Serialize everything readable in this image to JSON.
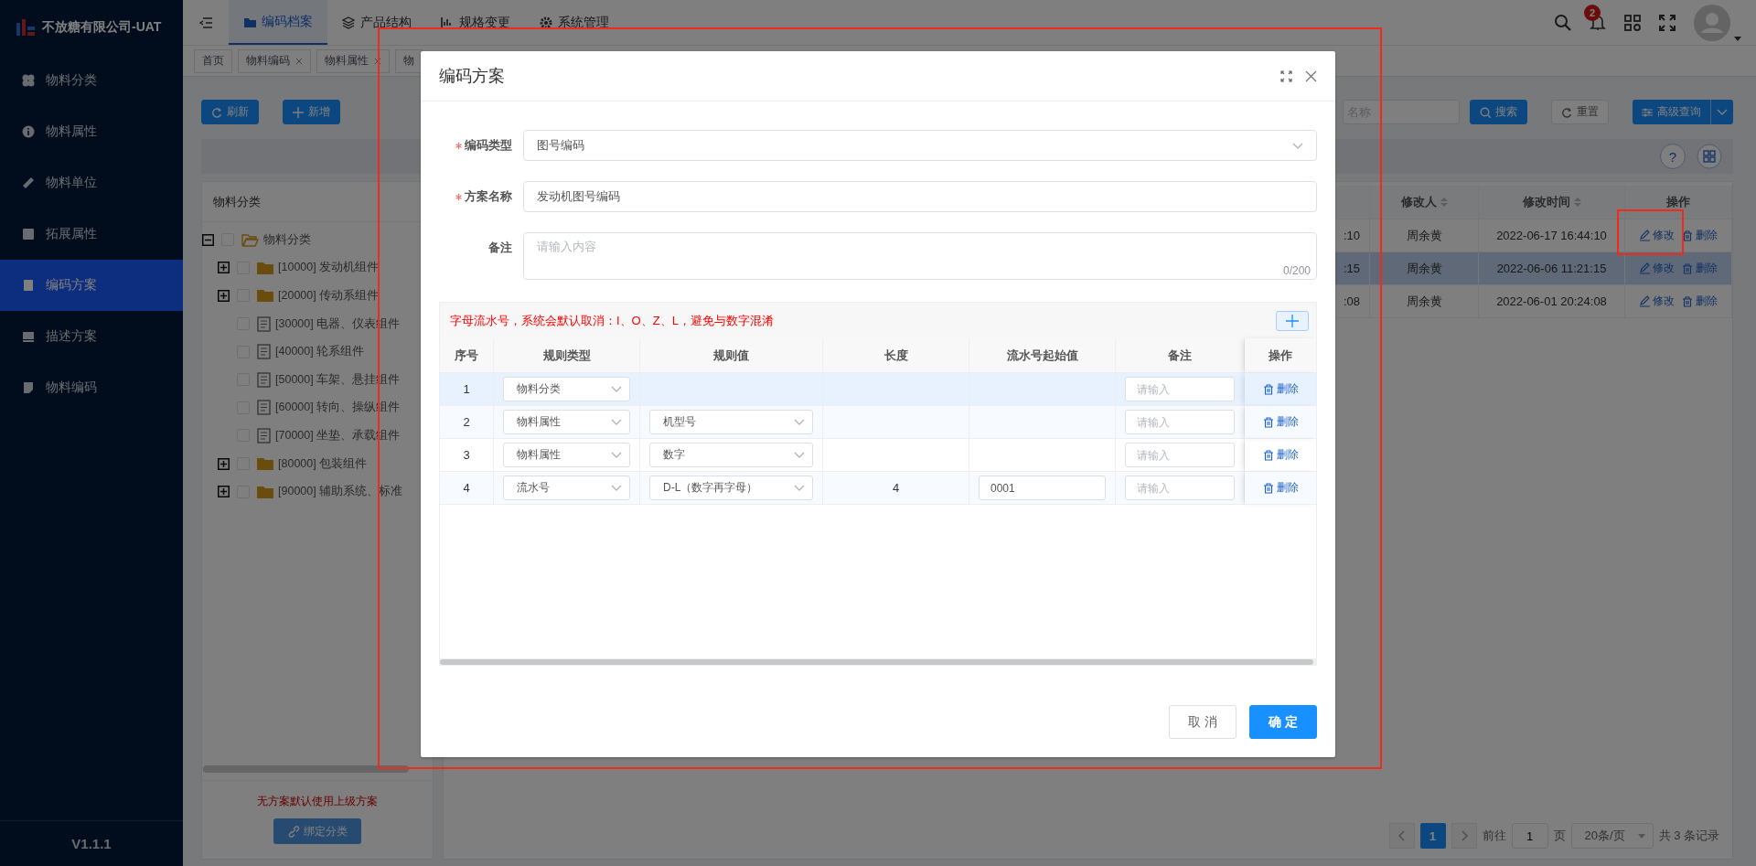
{
  "app": {
    "company": "不放糖有限公司-UAT",
    "version": "V1.1.1"
  },
  "sidebar": {
    "items": [
      {
        "label": "物料分类",
        "selected": false
      },
      {
        "label": "物料属性",
        "selected": false
      },
      {
        "label": "物料单位",
        "selected": false
      },
      {
        "label": "拓展属性",
        "selected": false
      },
      {
        "label": "编码方案",
        "selected": true
      },
      {
        "label": "描述方案",
        "selected": false
      },
      {
        "label": "物料编码",
        "selected": false
      }
    ]
  },
  "top_nav": {
    "tabs": [
      {
        "label": "编码档案",
        "selected": true
      },
      {
        "label": "产品结构",
        "selected": false
      },
      {
        "label": "规格变更",
        "selected": false
      },
      {
        "label": "系统管理",
        "selected": false
      }
    ],
    "notification_count": "2"
  },
  "tag_tabs": [
    {
      "label": "首页",
      "closable": false
    },
    {
      "label": "物料编码",
      "closable": true
    },
    {
      "label": "物料属性",
      "closable": true
    },
    {
      "label": "物",
      "closable": false
    }
  ],
  "toolbar": {
    "buttons": [
      {
        "label": "刷新",
        "kind": "refresh"
      },
      {
        "label": "新增",
        "kind": "add"
      }
    ],
    "search": {
      "placeholder": "名称"
    },
    "help_button": "?",
    "search_buttons": [
      {
        "label": "搜索",
        "kind": "search"
      },
      {
        "label": "重置",
        "kind": "reset"
      },
      {
        "label": "高级查询",
        "kind": "advanced"
      }
    ]
  },
  "category_panel": {
    "title": "物料分类",
    "tree": [
      {
        "label": "物料分类",
        "kind": "folder",
        "expanded": true,
        "checked": false,
        "children": [
          {
            "label": "[10000] 发动机组件",
            "kind": "folder",
            "expanded": false,
            "checked": false
          },
          {
            "label": "[20000] 传动系组件",
            "kind": "folder",
            "expanded": false,
            "checked": false
          },
          {
            "label": "[30000] 电器、仪表组件",
            "kind": "file",
            "checked": false
          },
          {
            "label": "[40000] 轮系组件",
            "kind": "file",
            "checked": false
          },
          {
            "label": "[50000] 车架、悬挂组件",
            "kind": "file",
            "checked": false
          },
          {
            "label": "[60000] 转向、操纵组件",
            "kind": "file",
            "checked": false
          },
          {
            "label": "[70000] 坐垫、承载组件",
            "kind": "file",
            "checked": false
          },
          {
            "label": "[80000] 包装组件",
            "kind": "folder",
            "expanded": false,
            "checked": false
          },
          {
            "label": "[90000] 辅助系统、标准",
            "kind": "folder",
            "expanded": false,
            "checked": false
          }
        ]
      }
    ],
    "note": "无方案默认使用上级方案",
    "bind_button": {
      "label": "绑定分类",
      "disabled": true
    }
  },
  "scheme_table": {
    "columns": [
      {
        "label": "修改人",
        "sortable": true
      },
      {
        "label": "修改时间",
        "sortable": true
      },
      {
        "label": "操作",
        "sortable": false
      }
    ],
    "rows": [
      {
        "column_1": ":10",
        "modifier": "周余黄",
        "modified": "2022-06-17 16:44:10",
        "edit": "修改",
        "delete": "删除",
        "highlighted": false
      },
      {
        "column_1": ":15",
        "modifier": "周余黄",
        "modified": "2022-06-06 11:21:15",
        "edit": "修改",
        "delete": "删除",
        "highlighted": true
      },
      {
        "column_1": ":08",
        "modifier": "周余黄",
        "modified": "2022-06-01 20:24:08",
        "edit": "修改",
        "delete": "删除",
        "highlighted": false
      }
    ]
  },
  "pagination": {
    "pages": [
      {
        "label": "1",
        "selected": true
      }
    ],
    "goto_label": "前往",
    "goto_value": "1",
    "page_unit": "页",
    "page_size": "20条/页",
    "total": "共 3 条记录"
  },
  "dialog": {
    "title": "编码方案",
    "fields": [
      {
        "kind": "select",
        "label": "编码类型",
        "required": true,
        "value": "图号编码"
      },
      {
        "kind": "text",
        "label": "方案名称",
        "required": true,
        "value": "发动机图号编码"
      },
      {
        "kind": "textarea",
        "label": "备注",
        "required": false,
        "placeholder": "请输入内容",
        "counter": "0/200"
      }
    ],
    "rules": {
      "note": "字母流水号，系统会默认取消：I、O、Z、L，避免与数字混淆",
      "columns": [
        "序号",
        "规则类型",
        "规则值",
        "长度",
        "流水号起始值",
        "备注",
        "操作"
      ],
      "rows": [
        {
          "index": "1",
          "rule_type": "物料分类",
          "remark_placeholder": "请输入",
          "action": "删除",
          "selected": true
        },
        {
          "index": "2",
          "rule_type": "物料属性",
          "rule_value": "机型号",
          "remark_placeholder": "请输入",
          "action": "删除",
          "selected": false
        },
        {
          "index": "3",
          "rule_type": "物料属性",
          "rule_value": "数字",
          "remark_placeholder": "请输入",
          "action": "删除",
          "selected": false
        },
        {
          "index": "4",
          "rule_type": "流水号",
          "rule_value": "D-L（数字再字母）",
          "length": "4",
          "start_value": "0001",
          "remark_placeholder": "请输入",
          "action": "删除",
          "selected": false
        }
      ]
    },
    "buttons": [
      {
        "label": "取 消",
        "kind": "default"
      },
      {
        "label": "确 定",
        "kind": "primary"
      }
    ]
  }
}
